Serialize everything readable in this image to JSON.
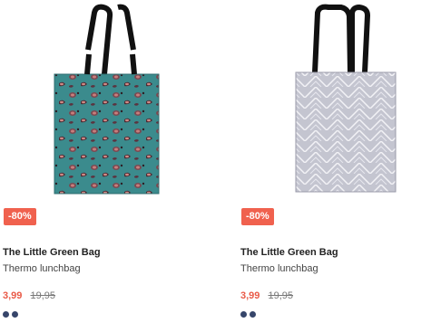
{
  "products": [
    {
      "title": "The Little Green Bag",
      "subtitle": "Thermo lunchbag",
      "badge": "-80%",
      "price": "3,99",
      "old_price": "19,95",
      "swatch_colors": [
        "#36456a",
        "#36456a"
      ],
      "pattern": "leopard"
    },
    {
      "title": "The Little Green Bag",
      "subtitle": "Thermo lunchbag",
      "badge": "-80%",
      "price": "3,99",
      "old_price": "19,95",
      "swatch_colors": [
        "#36456a",
        "#36456a"
      ],
      "pattern": "herringbone"
    }
  ],
  "colors": {
    "badge": "#f0614e",
    "sale_price": "#e95a47",
    "swatch": "#36456a",
    "leopard_base": "#3d8a8c",
    "herringbone_base": "#c9c9d3"
  }
}
